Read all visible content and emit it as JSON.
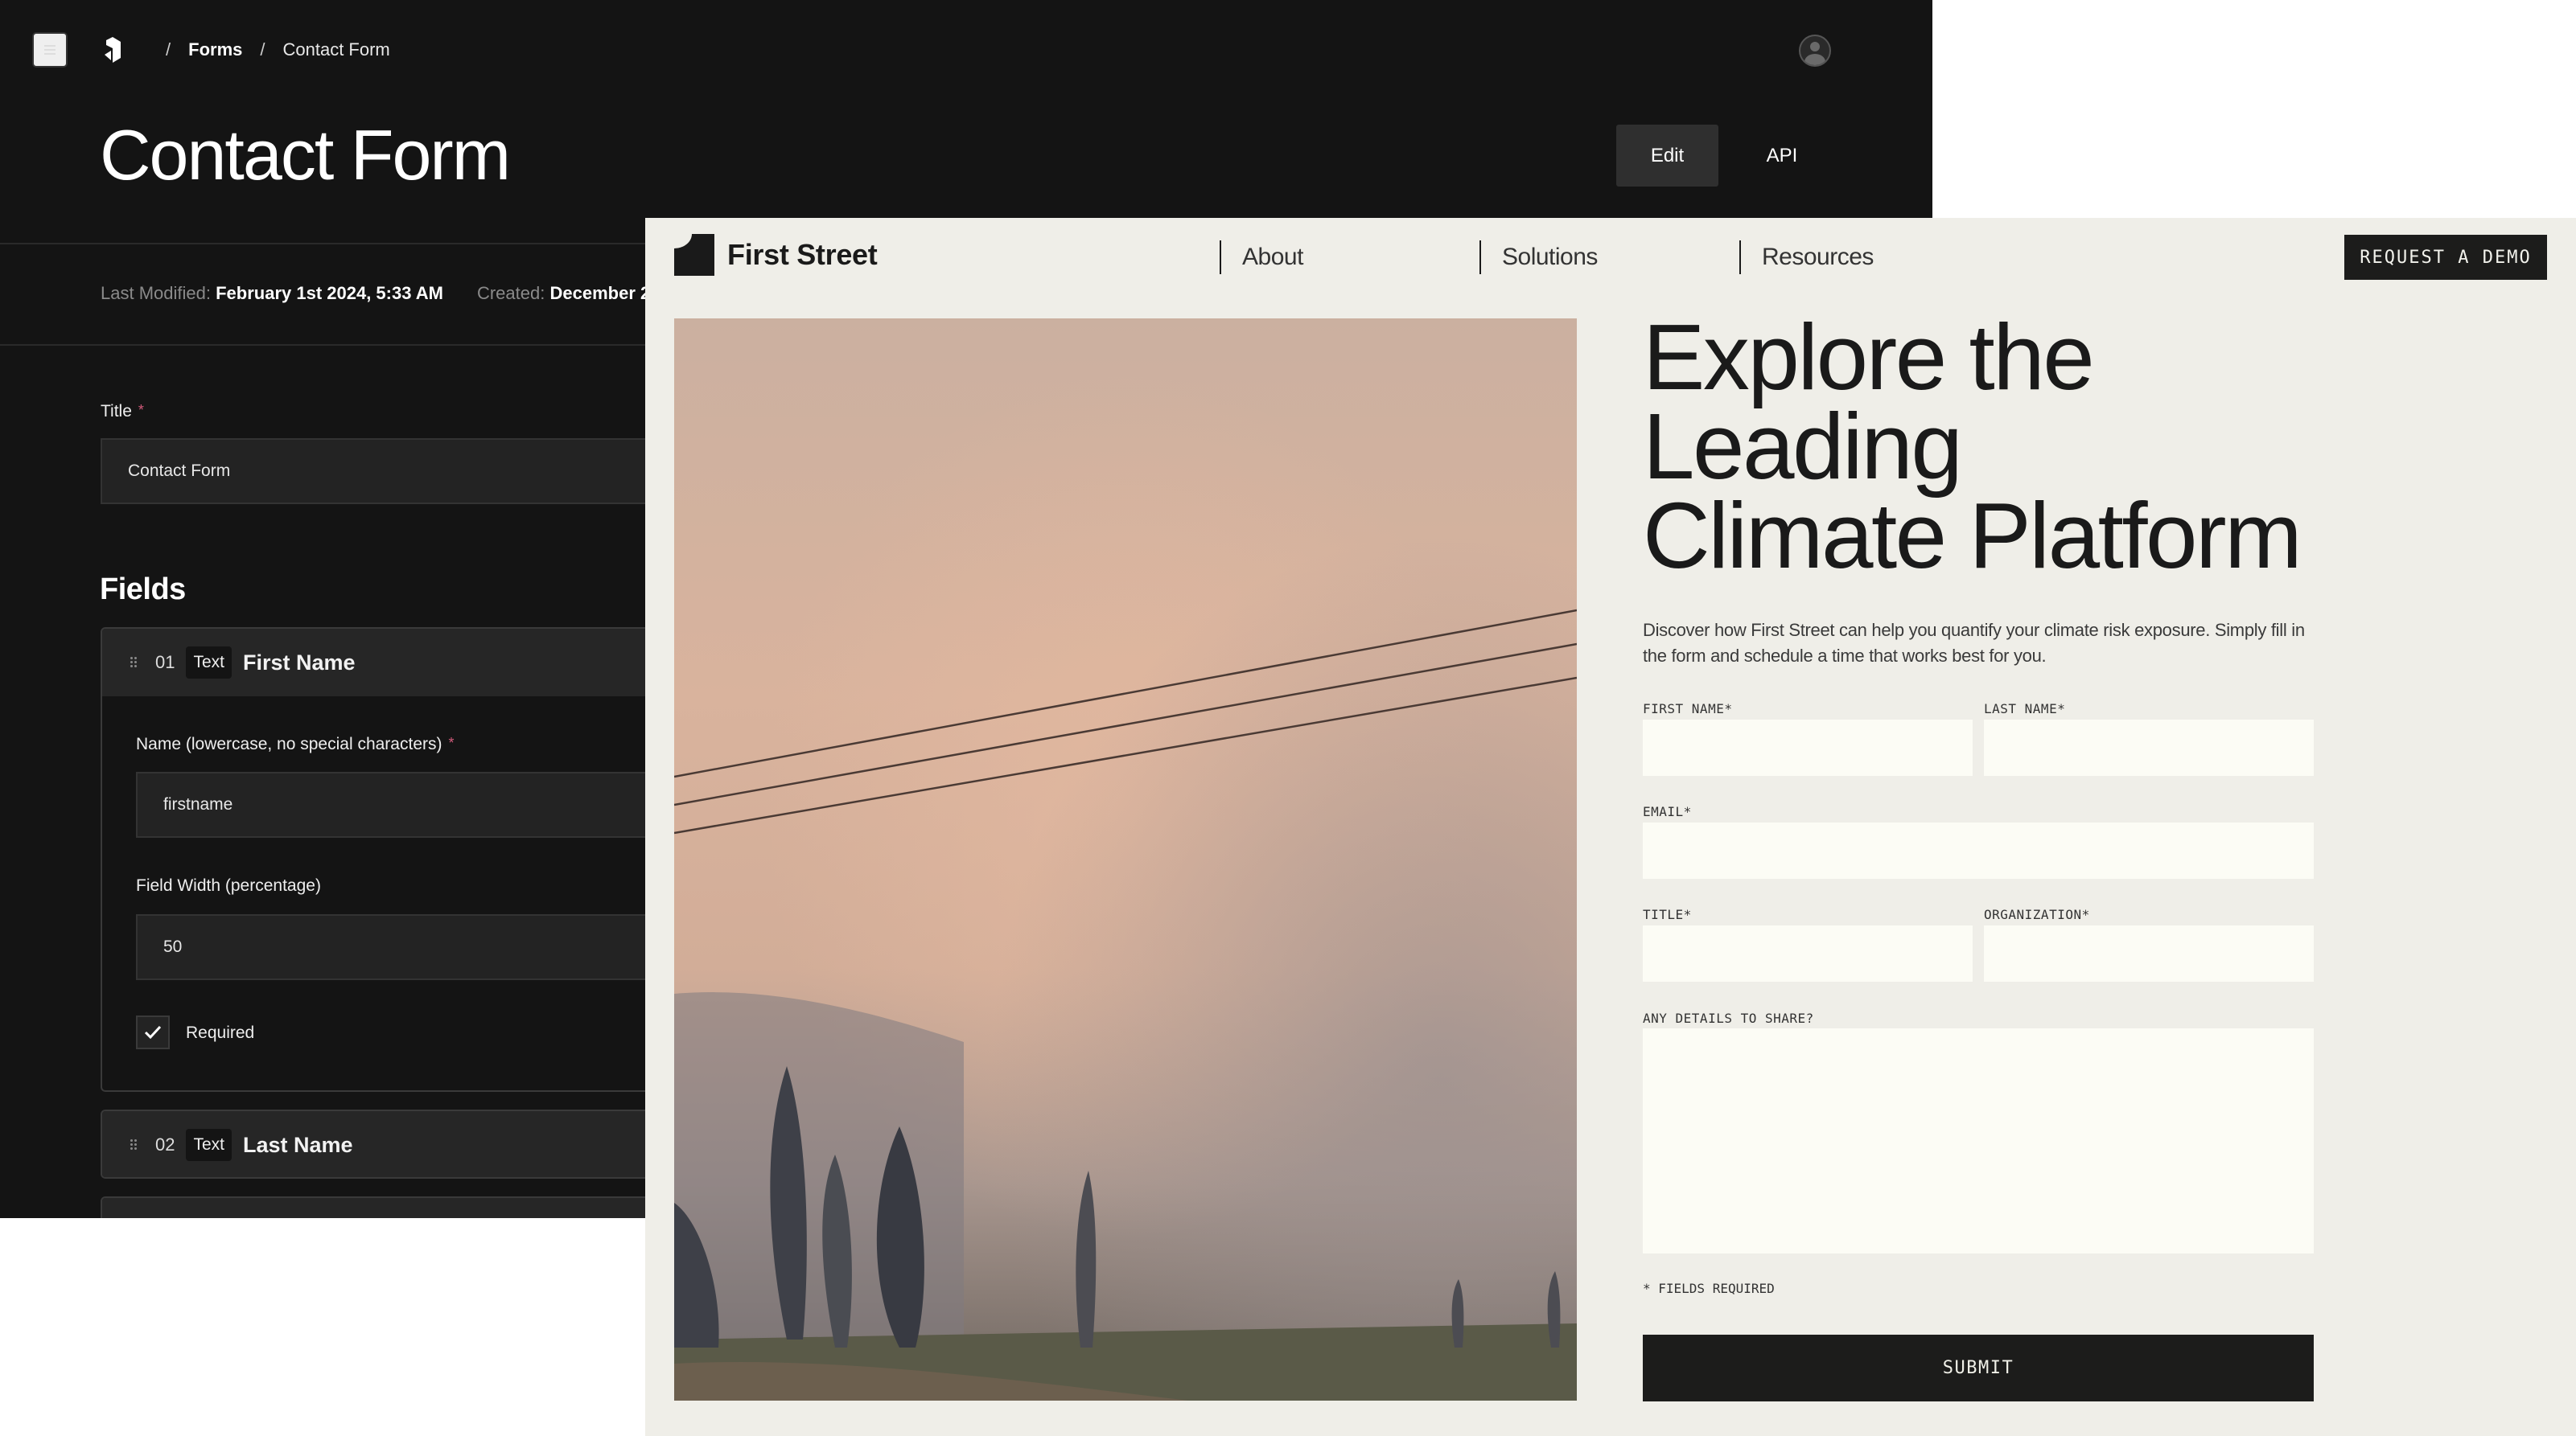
{
  "cms": {
    "breadcrumb": {
      "section": "Forms",
      "current": "Contact Form",
      "separator": "/"
    },
    "page_title": "Contact Form",
    "actions": {
      "edit": "Edit",
      "api": "API"
    },
    "meta": {
      "last_modified_label": "Last Modified:",
      "last_modified_value": "February 1st 2024, 5:33 AM",
      "created_label": "Created:",
      "created_value": "December 2"
    },
    "title_field": {
      "label": "Title",
      "required_mark": "*",
      "value": "Contact Form"
    },
    "fields_heading": "Fields",
    "fields": [
      {
        "number": "01",
        "type": "Text",
        "name": "First Name",
        "expanded": true,
        "name_label": "Name (lowercase, no special characters)",
        "name_required_mark": "*",
        "name_value": "firstname",
        "width_label": "Field Width (percentage)",
        "width_value": "50",
        "required_label": "Required",
        "required_checked": true
      },
      {
        "number": "02",
        "type": "Text",
        "name": "Last Name",
        "expanded": false
      }
    ]
  },
  "first_street": {
    "brand": "First Street",
    "nav": [
      "About",
      "Solutions",
      "Resources"
    ],
    "cta": "REQUEST A DEMO",
    "headline": [
      "Explore the",
      "Leading",
      "Climate Platform"
    ],
    "subtext": "Discover how First Street can help you quantify your climate risk exposure. Simply fill in the form and schedule a time that works best for you.",
    "form": {
      "first_name": {
        "label": "FIRST NAME*",
        "value": ""
      },
      "last_name": {
        "label": "LAST NAME*",
        "value": ""
      },
      "email": {
        "label": "EMAIL*",
        "value": ""
      },
      "title": {
        "label": "TITLE*",
        "value": ""
      },
      "organization": {
        "label": "ORGANIZATION*",
        "value": ""
      },
      "details": {
        "label": "ANY DETAILS TO SHARE?",
        "value": ""
      },
      "required_note": "* FIELDS REQUIRED",
      "submit": "SUBMIT"
    },
    "image_alt": "Smoky sky over cypress trees and power lines"
  },
  "colors": {
    "cms_bg": "#141414",
    "cms_input_bg": "#232323",
    "required_star": "#d05a7a",
    "fs_bg": "#efeee8",
    "fs_input_bg": "#fcfcf5",
    "fs_dark": "#1c1c1b"
  }
}
